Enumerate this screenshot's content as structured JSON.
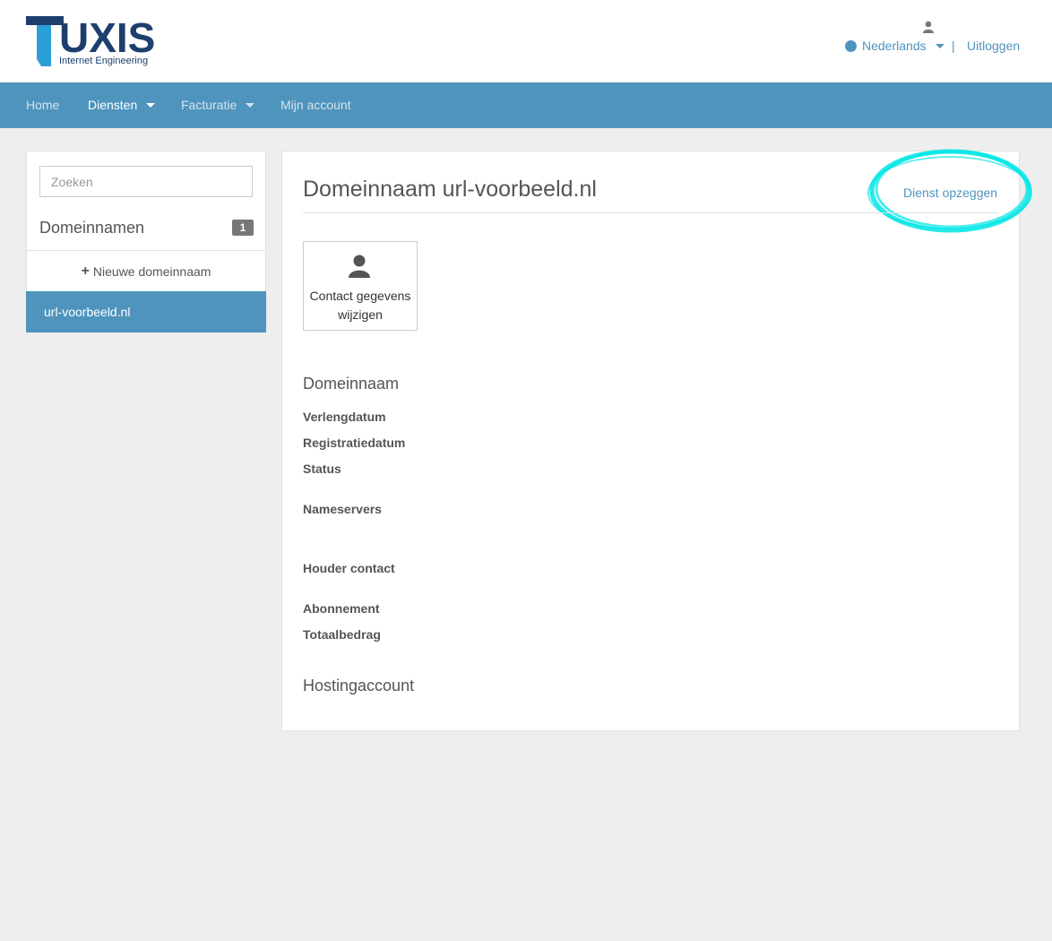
{
  "brand": {
    "name": "UXIS",
    "tagline": "Internet Engineering"
  },
  "header": {
    "language": "Nederlands",
    "separator": "|",
    "logout": "Uitloggen"
  },
  "nav": {
    "items": [
      {
        "label": "Home"
      },
      {
        "label": "Diensten"
      },
      {
        "label": "Facturatie"
      },
      {
        "label": "Mijn account"
      }
    ]
  },
  "sidebar": {
    "search_placeholder": "Zoeken",
    "title": "Domeinnamen",
    "count": "1",
    "new_label": "Nieuwe domeinnaam",
    "active_item": "url-voorbeeld.nl"
  },
  "main": {
    "title": "Domeinnaam url-voorbeeld.nl",
    "cancel_label": "Dienst opzeggen",
    "contact_button": "Contact gegevens wijzigen",
    "section_domain": "Domeinnaam",
    "fields": {
      "renewal": "Verlengdatum",
      "registration": "Registratiedatum",
      "status": "Status",
      "nameservers": "Nameservers",
      "holder": "Houder contact",
      "subscription": "Abonnement",
      "total": "Totaalbedrag"
    },
    "section_hosting": "Hostingaccount"
  },
  "colors": {
    "primary": "#4f94bd",
    "highlight": "#00e5e5",
    "brand_dark": "#1d3f6e"
  }
}
